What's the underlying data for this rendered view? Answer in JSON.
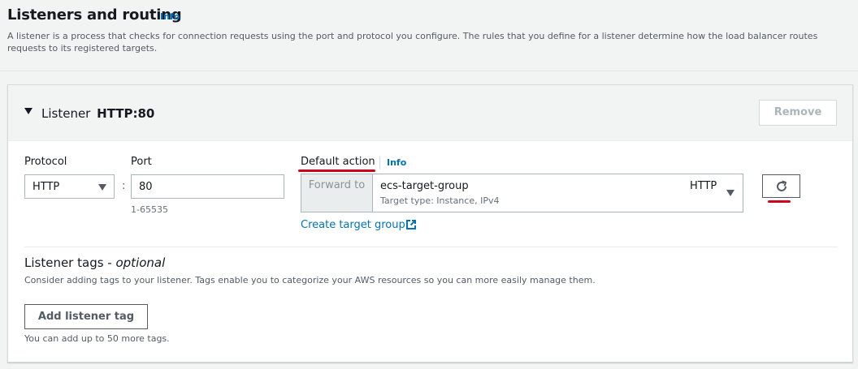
{
  "section": {
    "title": "Listeners and routing",
    "info_label": "Info",
    "description": "A listener is a process that checks for connection requests using the port and protocol you configure. The rules that you define for a listener determine how the load balancer routes requests to its registered targets."
  },
  "listener": {
    "label": "Listener",
    "value": "HTTP:80",
    "remove_label": "Remove",
    "protocol_label": "Protocol",
    "protocol_value": "HTTP",
    "port_label": "Port",
    "port_value": "80",
    "port_hint": "1-65535",
    "colon": ":",
    "default_action_label": "Default action",
    "default_action_info": "Info",
    "forward_to": "Forward to",
    "target_group_name": "ecs-target-group",
    "target_group_type": "Target type: Instance, IPv4",
    "target_group_protocol": "HTTP",
    "create_target_group_link": "Create target group"
  },
  "tags": {
    "title": "Listener tags - ",
    "title_optional": "optional",
    "description": "Consider adding tags to your listener. Tags enable you to categorize your AWS resources so you can more easily manage them.",
    "add_button": "Add listener tag",
    "note": "You can add up to 50 more tags."
  },
  "colors": {
    "link": "#0073bb",
    "annotation_underline": "#d0021b"
  }
}
